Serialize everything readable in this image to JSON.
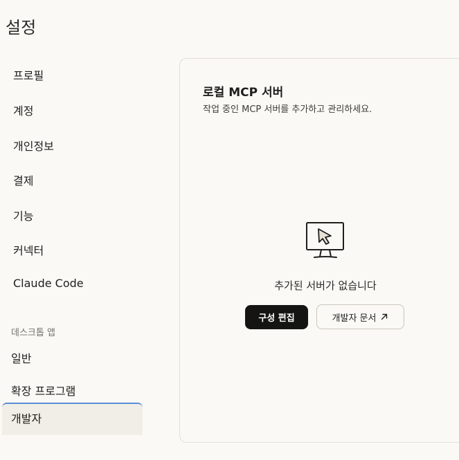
{
  "page": {
    "title": "설정"
  },
  "sidebar": {
    "items": [
      {
        "label": "프로필"
      },
      {
        "label": "계정"
      },
      {
        "label": "개인정보"
      },
      {
        "label": "결제"
      },
      {
        "label": "기능"
      },
      {
        "label": "커넥터"
      },
      {
        "label": "Claude Code"
      }
    ],
    "desktop_section": {
      "label": "데스크톱 앱",
      "items": [
        {
          "label": "일반"
        },
        {
          "label": "확장 프로그램"
        },
        {
          "label": "개발자",
          "active": true
        }
      ]
    }
  },
  "main": {
    "title": "로컬 MCP 서버",
    "description": "작업 중인 MCP 서버를 추가하고 관리하세요.",
    "empty_state": {
      "icon": "monitor-cursor-icon",
      "text": "추가된 서버가 없습니다"
    },
    "buttons": {
      "edit_config": "구성 편집",
      "developer_docs": "개발자 문서"
    }
  },
  "colors": {
    "background": "#faf9f5",
    "active_item_bg": "#f0eee6",
    "active_item_border": "#5b8dd6",
    "primary_button": "#141413"
  }
}
